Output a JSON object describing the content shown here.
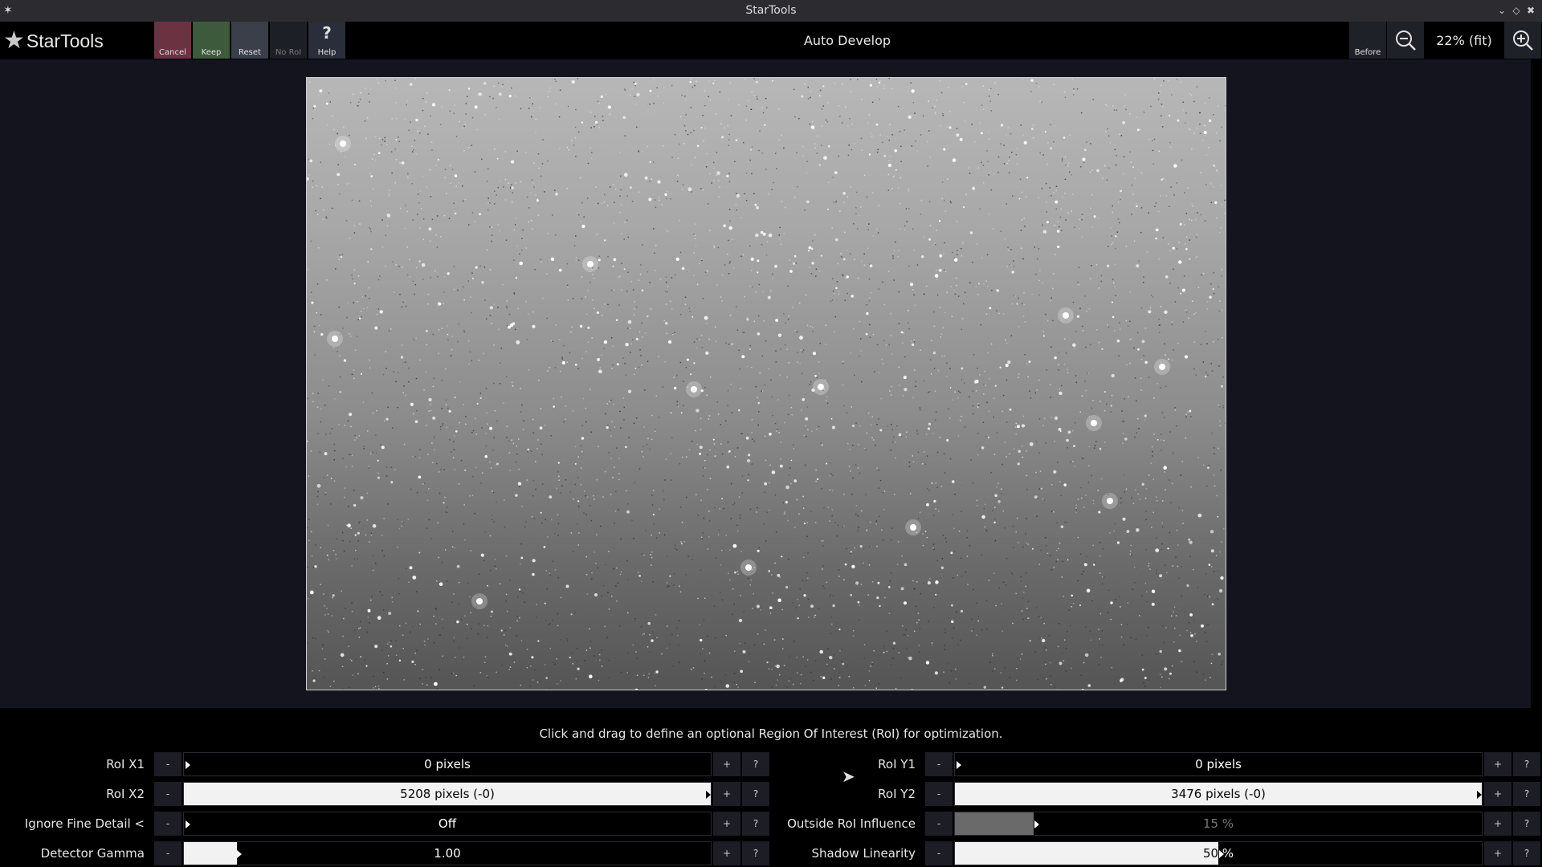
{
  "window": {
    "title": "StarTools"
  },
  "app": {
    "name": "StarTools"
  },
  "toolbar": {
    "cancel_label": "Cancel",
    "keep_label": "Keep",
    "reset_label": "Reset",
    "noroi_label": "No RoI",
    "help_label": "Help",
    "help_glyph": "?",
    "module_title": "Auto Develop",
    "before_label": "Before",
    "zoom_level": "22% (fit)"
  },
  "colors": {
    "cancel": "#6b3242",
    "keep": "#3d5a3d",
    "reset": "#3a3f4a",
    "noroi": "#1d1f26",
    "help": "#2a2e3a"
  },
  "panel": {
    "hint": "Click and drag to define an optional Region Of Interest (RoI) for optimization.",
    "minus": "-",
    "plus": "+",
    "help": "?",
    "left": [
      {
        "label": "RoI X1",
        "value": "0 pixels",
        "fill": 0.0
      },
      {
        "label": "RoI X2",
        "value": "5208 pixels (-0)",
        "fill": 1.0
      },
      {
        "label": "Ignore Fine Detail <",
        "value": "Off",
        "fill": 0.0
      },
      {
        "label": "Detector Gamma",
        "value": "1.00",
        "fill": 0.1
      }
    ],
    "right": [
      {
        "label": "RoI Y1",
        "value": "0 pixels",
        "fill": 0.0
      },
      {
        "label": "RoI Y2",
        "value": "3476 pixels (-0)",
        "fill": 1.0
      },
      {
        "label": "Outside RoI Influence",
        "value": "15 %",
        "fill": 0.15
      },
      {
        "label": "Shadow Linearity",
        "value": "50 %",
        "fill": 0.5
      }
    ]
  }
}
